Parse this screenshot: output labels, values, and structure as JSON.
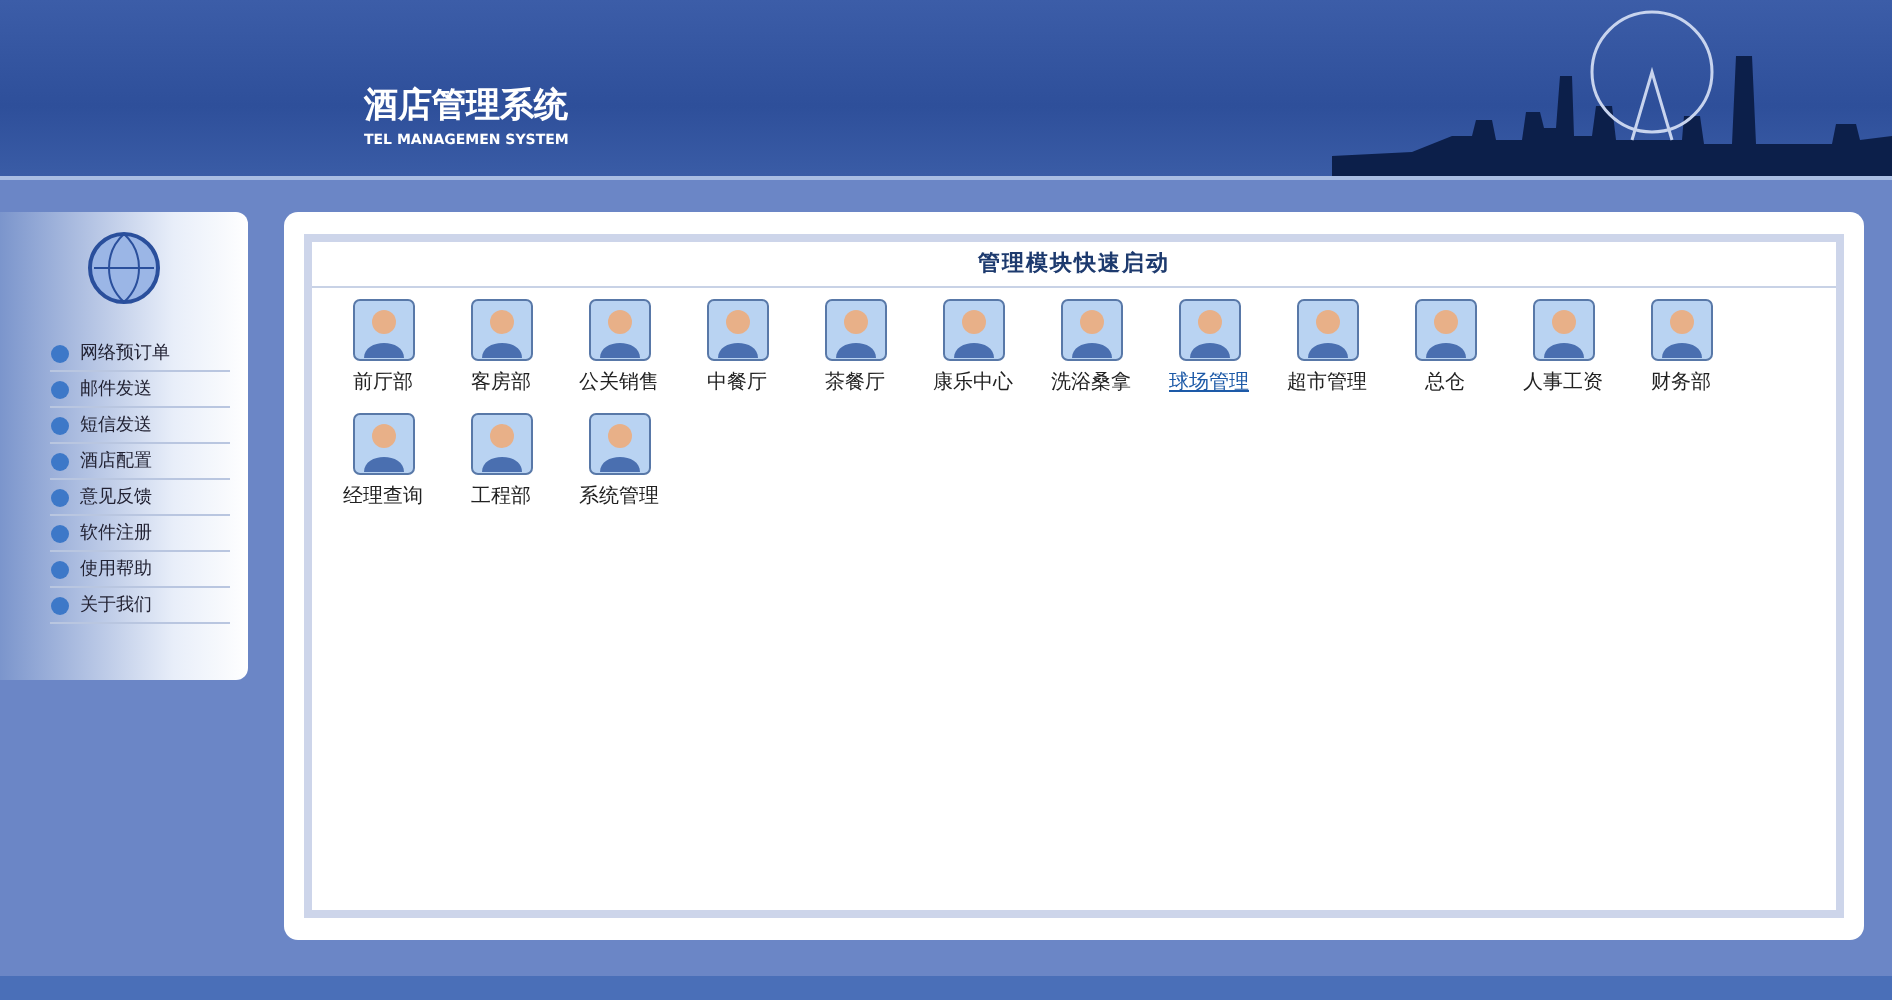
{
  "header": {
    "title": "酒店管理系统",
    "subtitle": "TEL MANAGEMEN SYSTEM"
  },
  "sidebar": {
    "items": [
      {
        "label": "网络预订单"
      },
      {
        "label": "邮件发送"
      },
      {
        "label": "短信发送"
      },
      {
        "label": "酒店配置"
      },
      {
        "label": "意见反馈"
      },
      {
        "label": "软件注册"
      },
      {
        "label": "使用帮助"
      },
      {
        "label": "关于我们"
      }
    ]
  },
  "panel": {
    "title": "管理模块快速启动",
    "modules": [
      {
        "label": "前厅部",
        "hovered": false
      },
      {
        "label": "客房部",
        "hovered": false
      },
      {
        "label": "公关销售",
        "hovered": false
      },
      {
        "label": "中餐厅",
        "hovered": false
      },
      {
        "label": "茶餐厅",
        "hovered": false
      },
      {
        "label": "康乐中心",
        "hovered": false
      },
      {
        "label": "洗浴桑拿",
        "hovered": false
      },
      {
        "label": "球场管理",
        "hovered": true
      },
      {
        "label": "超市管理",
        "hovered": false
      },
      {
        "label": "总仓",
        "hovered": false
      },
      {
        "label": "人事工资",
        "hovered": false
      },
      {
        "label": "财务部",
        "hovered": false
      },
      {
        "label": "经理查询",
        "hovered": false
      },
      {
        "label": "工程部",
        "hovered": false
      },
      {
        "label": "系统管理",
        "hovered": false
      }
    ]
  }
}
